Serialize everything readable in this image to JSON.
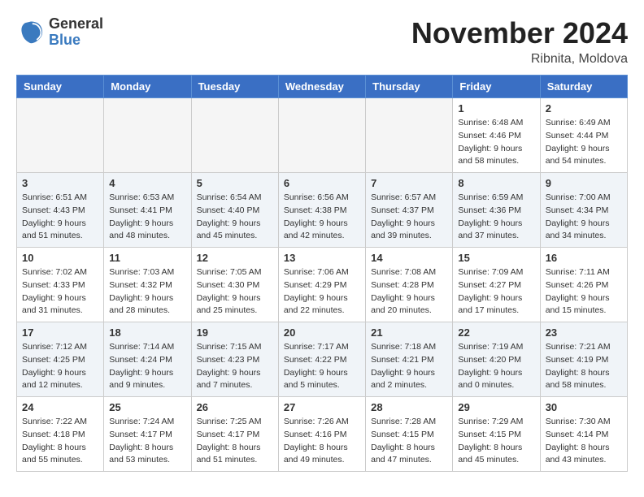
{
  "header": {
    "logo_line1": "General",
    "logo_line2": "Blue",
    "month_title": "November 2024",
    "location": "Ribnita, Moldova"
  },
  "weekdays": [
    "Sunday",
    "Monday",
    "Tuesday",
    "Wednesday",
    "Thursday",
    "Friday",
    "Saturday"
  ],
  "weeks": [
    [
      {
        "day": "",
        "info": ""
      },
      {
        "day": "",
        "info": ""
      },
      {
        "day": "",
        "info": ""
      },
      {
        "day": "",
        "info": ""
      },
      {
        "day": "",
        "info": ""
      },
      {
        "day": "1",
        "info": "Sunrise: 6:48 AM\nSunset: 4:46 PM\nDaylight: 9 hours\nand 58 minutes."
      },
      {
        "day": "2",
        "info": "Sunrise: 6:49 AM\nSunset: 4:44 PM\nDaylight: 9 hours\nand 54 minutes."
      }
    ],
    [
      {
        "day": "3",
        "info": "Sunrise: 6:51 AM\nSunset: 4:43 PM\nDaylight: 9 hours\nand 51 minutes."
      },
      {
        "day": "4",
        "info": "Sunrise: 6:53 AM\nSunset: 4:41 PM\nDaylight: 9 hours\nand 48 minutes."
      },
      {
        "day": "5",
        "info": "Sunrise: 6:54 AM\nSunset: 4:40 PM\nDaylight: 9 hours\nand 45 minutes."
      },
      {
        "day": "6",
        "info": "Sunrise: 6:56 AM\nSunset: 4:38 PM\nDaylight: 9 hours\nand 42 minutes."
      },
      {
        "day": "7",
        "info": "Sunrise: 6:57 AM\nSunset: 4:37 PM\nDaylight: 9 hours\nand 39 minutes."
      },
      {
        "day": "8",
        "info": "Sunrise: 6:59 AM\nSunset: 4:36 PM\nDaylight: 9 hours\nand 37 minutes."
      },
      {
        "day": "9",
        "info": "Sunrise: 7:00 AM\nSunset: 4:34 PM\nDaylight: 9 hours\nand 34 minutes."
      }
    ],
    [
      {
        "day": "10",
        "info": "Sunrise: 7:02 AM\nSunset: 4:33 PM\nDaylight: 9 hours\nand 31 minutes."
      },
      {
        "day": "11",
        "info": "Sunrise: 7:03 AM\nSunset: 4:32 PM\nDaylight: 9 hours\nand 28 minutes."
      },
      {
        "day": "12",
        "info": "Sunrise: 7:05 AM\nSunset: 4:30 PM\nDaylight: 9 hours\nand 25 minutes."
      },
      {
        "day": "13",
        "info": "Sunrise: 7:06 AM\nSunset: 4:29 PM\nDaylight: 9 hours\nand 22 minutes."
      },
      {
        "day": "14",
        "info": "Sunrise: 7:08 AM\nSunset: 4:28 PM\nDaylight: 9 hours\nand 20 minutes."
      },
      {
        "day": "15",
        "info": "Sunrise: 7:09 AM\nSunset: 4:27 PM\nDaylight: 9 hours\nand 17 minutes."
      },
      {
        "day": "16",
        "info": "Sunrise: 7:11 AM\nSunset: 4:26 PM\nDaylight: 9 hours\nand 15 minutes."
      }
    ],
    [
      {
        "day": "17",
        "info": "Sunrise: 7:12 AM\nSunset: 4:25 PM\nDaylight: 9 hours\nand 12 minutes."
      },
      {
        "day": "18",
        "info": "Sunrise: 7:14 AM\nSunset: 4:24 PM\nDaylight: 9 hours\nand 9 minutes."
      },
      {
        "day": "19",
        "info": "Sunrise: 7:15 AM\nSunset: 4:23 PM\nDaylight: 9 hours\nand 7 minutes."
      },
      {
        "day": "20",
        "info": "Sunrise: 7:17 AM\nSunset: 4:22 PM\nDaylight: 9 hours\nand 5 minutes."
      },
      {
        "day": "21",
        "info": "Sunrise: 7:18 AM\nSunset: 4:21 PM\nDaylight: 9 hours\nand 2 minutes."
      },
      {
        "day": "22",
        "info": "Sunrise: 7:19 AM\nSunset: 4:20 PM\nDaylight: 9 hours\nand 0 minutes."
      },
      {
        "day": "23",
        "info": "Sunrise: 7:21 AM\nSunset: 4:19 PM\nDaylight: 8 hours\nand 58 minutes."
      }
    ],
    [
      {
        "day": "24",
        "info": "Sunrise: 7:22 AM\nSunset: 4:18 PM\nDaylight: 8 hours\nand 55 minutes."
      },
      {
        "day": "25",
        "info": "Sunrise: 7:24 AM\nSunset: 4:17 PM\nDaylight: 8 hours\nand 53 minutes."
      },
      {
        "day": "26",
        "info": "Sunrise: 7:25 AM\nSunset: 4:17 PM\nDaylight: 8 hours\nand 51 minutes."
      },
      {
        "day": "27",
        "info": "Sunrise: 7:26 AM\nSunset: 4:16 PM\nDaylight: 8 hours\nand 49 minutes."
      },
      {
        "day": "28",
        "info": "Sunrise: 7:28 AM\nSunset: 4:15 PM\nDaylight: 8 hours\nand 47 minutes."
      },
      {
        "day": "29",
        "info": "Sunrise: 7:29 AM\nSunset: 4:15 PM\nDaylight: 8 hours\nand 45 minutes."
      },
      {
        "day": "30",
        "info": "Sunrise: 7:30 AM\nSunset: 4:14 PM\nDaylight: 8 hours\nand 43 minutes."
      }
    ]
  ]
}
